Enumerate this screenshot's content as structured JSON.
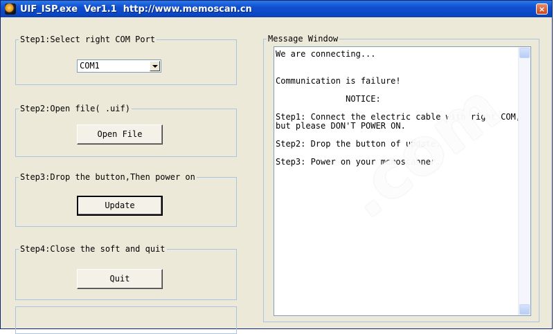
{
  "window": {
    "title": "UIF_ISP.exe  Ver1.1  http://www.memoscan.cn",
    "close_label": "×"
  },
  "steps": [
    {
      "legend": "Step1:Select right COM Port",
      "combo_value": "COM1"
    },
    {
      "legend": "Step2:Open file( .uif)",
      "button_label": "Open File"
    },
    {
      "legend": "Step3:Drop the button,Then power on",
      "button_label": "Update"
    },
    {
      "legend": "Step4:Close the soft and quit",
      "button_label": "Quit"
    }
  ],
  "message_window": {
    "legend": "Message Window",
    "lines": [
      "We are connecting...",
      "",
      "",
      "Communication is failure!",
      "",
      "              NOTICE:",
      "",
      "Step1: Connect the electric cable with right COM,",
      "but please DON'T POWER ON.",
      "",
      "Step2: Drop the button of update.",
      "",
      "Step3: Power on your memoscanner."
    ]
  },
  "watermark": {
    "text": ".com"
  },
  "colors": {
    "title_bar": "#0b46c2",
    "window_bg": "#ece9d8",
    "groupbox_border": "#a9c4e0"
  }
}
